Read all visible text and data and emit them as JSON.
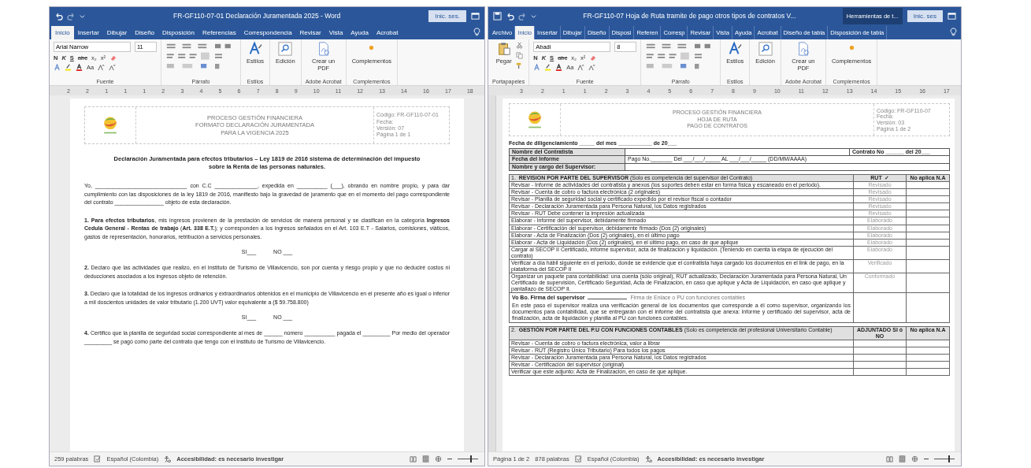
{
  "windows": [
    {
      "kind": "declaration",
      "title": "FR-GF110-07-01 Declaración Juramentada 2025  -  Word",
      "account": "Inic. ses.",
      "tabs": [
        {
          "label": "Inicio",
          "selected": true
        },
        {
          "label": "Insertar",
          "selected": false
        },
        {
          "label": "Dibujar",
          "selected": false
        },
        {
          "label": "Diseño",
          "selected": false
        },
        {
          "label": "Disposición",
          "selected": false
        },
        {
          "label": "Referencias",
          "selected": false
        },
        {
          "label": "Correspondencia",
          "selected": false
        },
        {
          "label": "Revisar",
          "selected": false
        },
        {
          "label": "Vista",
          "selected": false
        },
        {
          "label": "Ayuda",
          "selected": false
        },
        {
          "label": "Acrobat",
          "selected": false
        }
      ],
      "ribbon": [
        {
          "kind": "font",
          "label": "Fuente",
          "font": "Arial Narrow",
          "size": "11",
          "buttons": [
            "N",
            "K",
            "S",
            "abc",
            "x₂",
            "x²"
          ],
          "case_button": "Aa"
        },
        {
          "kind": "paragraph",
          "label": "Párrafo"
        },
        {
          "kind": "styles",
          "label": "Estilos",
          "button": "Estilos"
        },
        {
          "kind": "edit",
          "button": "Edición"
        },
        {
          "kind": "pdf",
          "label": "Adobe Acrobat",
          "button": "Crear un PDF"
        },
        {
          "kind": "addins",
          "label": "Complementos",
          "button": "Complementos"
        }
      ],
      "ruler": [
        "2",
        "2",
        "1",
        "1",
        "1",
        "2",
        "3",
        "4",
        "5",
        "6",
        "7",
        "8",
        "9",
        "10",
        "11",
        "12",
        "13",
        "14",
        "16",
        "17",
        "18"
      ],
      "status": {
        "words": "259 palabras",
        "language": "Español (Colombia)",
        "accessibility": "Accesibilidad: es necesario investigar",
        "zoom": {
          "level": 0.6
        }
      },
      "document": {
        "header": {
          "org": [
            "PROCESO GESTIÓN FINANCIERA",
            "FORMATO DECLARACIÓN JURAMENTADA",
            "PARA LA VIGENCIA 2025"
          ],
          "meta": [
            "Código: FR-GF110-07-01",
            "Fecha:",
            "Versión: 07",
            "Página 1 de 1"
          ]
        },
        "title": "Declaración Juramentada para efectos tributarios – Ley 1819 de 2016 sistema de determinación del impuesto sobre la Renta de las personas naturales.",
        "blocks": [
          {
            "kind": "para",
            "text": "Yo, ______________________________ con C.C ______________, expedida en __________ (___), obrando en nombre propio, y para dar cumplimiento con las disposiciones de la ley 1819 de 2016, manifiesto bajo la gravedad de juramento que en el momento del pago correspondiente del contrato ________________ objeto de esta declaración."
          },
          {
            "kind": "para",
            "text": "**1.  Para efectos tributarios**, mis ingresos provienen de la prestación de servicios de manera personal y se clasifican en la categoría **Ingresos Cedula General - Rentas de trabajo** (**Art. 338 E.T.**); y corresponden a los ingresos señalados en el Art. 103 E.T - Salarios, comisiones, viáticos, gastos de representación, honorarios, retribución a servicios personales."
          },
          {
            "kind": "yesno",
            "yes": "SI___",
            "no": "NO ___"
          },
          {
            "kind": "para",
            "text": "**2.** Declaro que las actividades que realizo, en el Instituto de Turismo de Villavicencio, son por cuenta y riesgo propio y que no deduciré costos ni deducciones asociados a los ingresos objeto de retención."
          },
          {
            "kind": "para",
            "text": "**3.** Declaro que la totalidad de los ingresos ordinarios y extraordinarios obtenidos en el municipio de Villavicencio en el presente año es igual o inferior a mil doscientos unidades de valor tributario (1.200 UVT) valor equivalente a ($ 59.758.800)"
          },
          {
            "kind": "yesno",
            "yes": "SI___",
            "no": "NO ___"
          },
          {
            "kind": "para",
            "text": "**4.** Certifico que la planilla de seguridad social correspondiente al mes de ______ número __________ pagada el _________ Por medio del operador _________ se pagó como parte del contrato que tengo con el Instituto de Turismo de Villavicencio."
          }
        ]
      }
    },
    {
      "kind": "route_sheet",
      "title": "FR-GF110-07 Hoja de Ruta tramite de pago otros tipos de contratos V...",
      "context": "Herramientas de t...",
      "account": "Inic. ses",
      "tabs": [
        {
          "label": "Archivo",
          "selected": false
        },
        {
          "label": "Inicio",
          "selected": true
        },
        {
          "label": "Insertar",
          "selected": false
        },
        {
          "label": "Dibujar",
          "selected": false
        },
        {
          "label": "Diseño",
          "selected": false
        },
        {
          "label": "Disposi",
          "selected": false
        },
        {
          "label": "Referen",
          "selected": false
        },
        {
          "label": "Corresp",
          "selected": false
        },
        {
          "label": "Revisar",
          "selected": false
        },
        {
          "label": "Vista",
          "selected": false
        },
        {
          "label": "Ayuda",
          "selected": false
        },
        {
          "label": "Acrobat",
          "selected": false
        },
        {
          "label": "Diseño de tabla",
          "selected": false
        },
        {
          "label": "Disposición de tabla",
          "selected": false
        }
      ],
      "ribbon": [
        {
          "kind": "clipboard",
          "label": "Portapapeles",
          "button": "Pegar"
        },
        {
          "kind": "font",
          "label": "Fuente",
          "font": "Abadi",
          "size": "8",
          "buttons": [
            "N",
            "K",
            "S",
            "abc",
            "x₂",
            "x²"
          ],
          "case_button": "Aa"
        },
        {
          "kind": "paragraph",
          "label": "Párrafo"
        },
        {
          "kind": "styles",
          "label": "Estilos",
          "button": "Estilos"
        },
        {
          "kind": "edit",
          "button": "Edición"
        },
        {
          "kind": "pdf",
          "label": "Adobe Acrobat",
          "button": "Crear un PDF"
        },
        {
          "kind": "addins",
          "label": "Complementos",
          "button": "Complementos"
        }
      ],
      "ruler": [
        "3",
        "2",
        "1",
        "1",
        "2",
        "3",
        "4",
        "5",
        "6",
        "7",
        "8",
        "9",
        "10",
        "11",
        "12",
        "13",
        "14",
        "15",
        "16",
        "17"
      ],
      "status": {
        "page": "Página 1 de 2",
        "words": "878 palabras",
        "language": "Español (Colombia)",
        "accessibility": "Accesibilidad: es necesario investigar",
        "zoom": {
          "level": 0.7
        }
      },
      "document": {
        "header": {
          "org": [
            "PROCESO GESTIÓN FINANCIERA",
            "HOJA DE RUTA",
            "PAGO DE CONTRATOS"
          ],
          "meta": [
            "Código: FR-GF110-07",
            "Fecha:",
            "Versión: 03",
            "Página 1 de 2"
          ]
        },
        "date_line": "Fecha de diligenciamiento _____ del mes ___________ de 20___",
        "info": [
          {
            "label": "Nombre del Contratista",
            "extra": "Contrato No ______ del 20___"
          },
          {
            "label": "Fecha del Informe",
            "value": "Pago No._______ Del ___/___/_____ AL ___/___/_____ (DD/MM/AAAA)"
          },
          {
            "label": "Nombre y cargo del Supervisor:"
          }
        ],
        "sections": [
          {
            "number": "1.",
            "heading": "**REVISION POR PARTE DEL SUPERVISOR** (Solo es competencia del supervisor del Contrato)",
            "col2": "RUT",
            "col2_mark": "✓",
            "col3": "No aplica N.A",
            "rows": [
              {
                "text": "Revisar - Informe de actividades del contratista y anexos (los soportes deben estar en forma física y escaneado en el periodo).",
                "status": "Revisado"
              },
              {
                "text": "Revisar - Cuenta de cobro o factura electrónica (2 originales)",
                "status": "Revisado"
              },
              {
                "text": "Revisar - Planilla de seguridad social y certificado expedido por el revisor fiscal o contador",
                "status": "Revisado"
              },
              {
                "text": "Revisar - Declaración Juramentada para Persona Natural, los Datos registrados",
                "status": "Revisado"
              },
              {
                "text": "Revisar - RUT Debe contener la impresión actualizada",
                "status": "Revisado"
              },
              {
                "text": "Elaborar - Informe del supervisor, debidamente firmado",
                "status": "Elaborado"
              },
              {
                "text": "Elaborar - Certificación del supervisor, debidamente firmado (Dos (2) originales)",
                "status": "Elaborado"
              },
              {
                "text": "Elaborar - Acta de Finalización (Dos (2) originales), en el último pago",
                "status": "Elaborado"
              },
              {
                "text": "Elaborar - Acta de Liquidación (Dos (2) originales), en el último pago, en caso de que aplique",
                "status": "Elaborado"
              },
              {
                "text": "Cargar al SECOP II Certificado, informe supervisor, acta de finalización y liquidación. (Teniendo en cuenta la etapa de ejecución del contrato)",
                "status": "Elaborado"
              },
              {
                "text": "Verificar a día hábil siguiente en el periodo, donde se evidencie que el contratista haya cargado los documentos en el link de pago, en la plataforma del SECOP II",
                "status": "Verificado"
              },
              {
                "text": "Organizar un paquete para contabilidad: una cuenta (sólo original), RUT actualizado, Declaración Juramentada para Persona Natural, Un Certificado de supervisión, Certificado Seguridad, Acta de Finalización, en caso que aplique y Acta de Liquidación, en caso que aplique y pantallazo de SECOP II.",
                "status": "Conformado"
              }
            ],
            "signoff": {
              "label": "Vo Bo. Firma del supervisor",
              "note": "Firma de Enlace o PU con funciones contables",
              "text": "En este paso el supervisor realiza una verificación general de los documentos que corresponde a él como supervisor, organizando los documentos para contabilidad, que se entregarán con el informe del contratista que anexa: informe y certificado del supervisor, acta de finalización, acta de liquidación y planilla al PU con funciones contables."
            }
          },
          {
            "number": "2.",
            "heading": "**GESTIÓN POR PARTE DEL P.U CON FUNCIONES CONTABLES** (Solo es competencia del profesional Universitario Contable)",
            "col2": "ADJUNTADO SI ó NO",
            "col3": "No aplica N.A",
            "rows": [
              {
                "text": "Revisar - Cuenta de cobro o factura electrónica, valor a librar"
              },
              {
                "text": "Revisar - RUT (Registro Único Tributario) Para todos los pagos"
              },
              {
                "text": "Revisar - Declaración Juramentada para Persona Natural, los Datos registrados"
              },
              {
                "text": "Revisar - Certificación del supervisor (original)"
              },
              {
                "text": "Verificar que este adjunto: Acta de Finalización, en caso de que aplique."
              }
            ]
          }
        ]
      }
    }
  ]
}
